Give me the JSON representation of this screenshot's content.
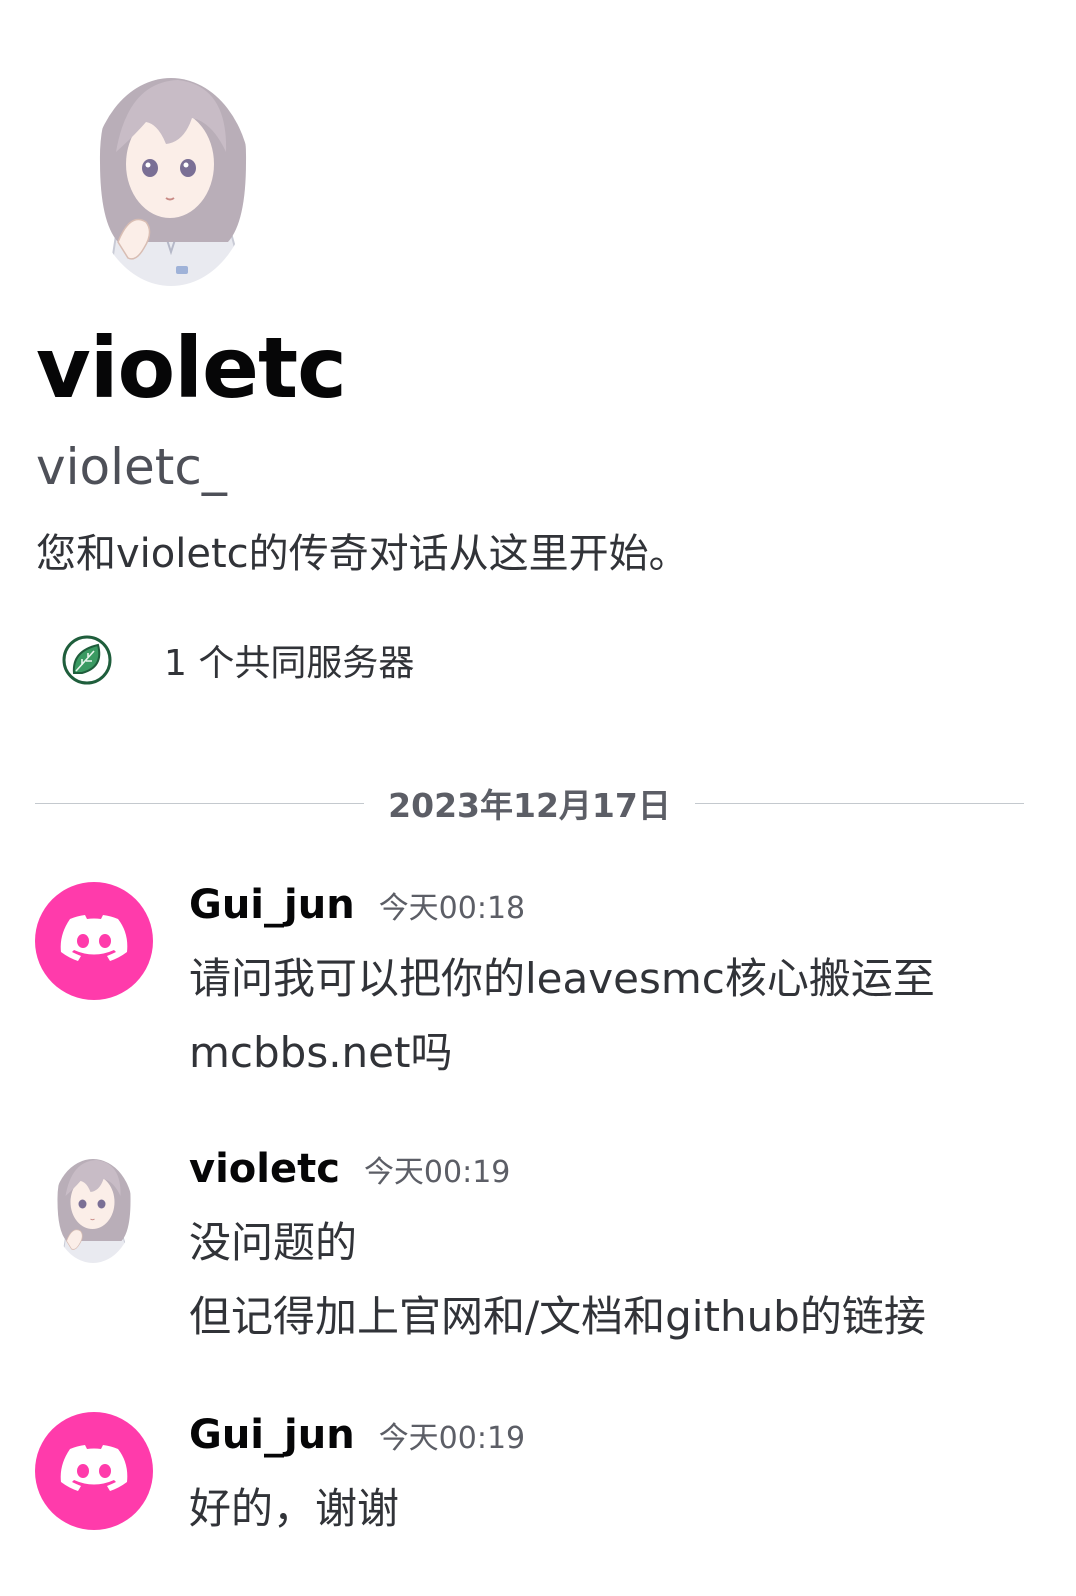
{
  "profile": {
    "display_name": "violetc",
    "username": "violetc_",
    "intro": "您和violetc的传奇对话从这里开始。",
    "mutual_servers": "1 个共同服务器"
  },
  "date_divider": "2023年12月17日",
  "messages": [
    {
      "author": "Gui_jun",
      "time": "今天00:18",
      "avatar": "discord-logo-icon",
      "lines": [
        "请问我可以把你的leavesmc核心搬运至",
        "mcbbs.net吗"
      ]
    },
    {
      "author": "violetc",
      "time": "今天00:19",
      "avatar": "anime-girl-avatar",
      "lines": [
        "没问题的",
        "但记得加上官网和/文档和github的链接"
      ]
    },
    {
      "author": "Gui_jun",
      "time": "今天00:19",
      "avatar": "discord-logo-icon",
      "lines": [
        "好的，谢谢"
      ]
    }
  ],
  "colors": {
    "discord_avatar_bg": "#ff3bab",
    "leaf_green": "#2e8b57",
    "text_primary": "#060607",
    "text_secondary": "#5c5e66"
  }
}
